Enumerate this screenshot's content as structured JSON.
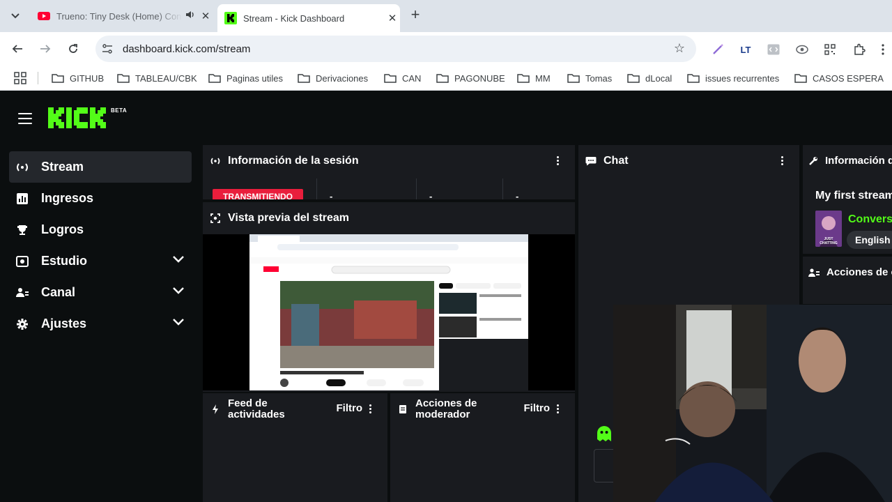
{
  "browser": {
    "tabs": [
      {
        "title": "Trueno: Tiny Desk (Home) Concert",
        "active": false
      },
      {
        "title": "Stream - Kick Dashboard",
        "active": true
      }
    ],
    "url": "dashboard.kick.com/stream",
    "bookmarks": [
      "GITHUB",
      "TABLEAU/CBK",
      "Paginas utiles",
      "Derivaciones",
      "CAN",
      "PAGONUBE",
      "MM",
      "Tomas",
      "dLocal",
      "issues recurrentes",
      "CASOS ESPERA"
    ]
  },
  "app": {
    "logo_badge": "BETA",
    "sidebar": [
      {
        "label": "Stream",
        "icon": "broadcast-icon",
        "active": true,
        "expandable": false
      },
      {
        "label": "Ingresos",
        "icon": "chart-icon",
        "active": false,
        "expandable": false
      },
      {
        "label": "Logros",
        "icon": "trophy-icon",
        "active": false,
        "expandable": false
      },
      {
        "label": "Estudio",
        "icon": "studio-icon",
        "active": false,
        "expandable": true
      },
      {
        "label": "Canal",
        "icon": "channel-icon",
        "active": false,
        "expandable": true
      },
      {
        "label": "Ajustes",
        "icon": "gear-icon",
        "active": false,
        "expandable": true
      }
    ],
    "session": {
      "title": "Información de la sesión",
      "status": "TRANSMITIENDO",
      "stats": [
        "-",
        "-",
        "-"
      ]
    },
    "preview": {
      "title": "Vista previa del stream"
    },
    "chat": {
      "title": "Chat"
    },
    "stream_info": {
      "title": "Información de stream",
      "stream_title": "My first stream",
      "category": "Conversando",
      "category_badge": "JUST CHATTING",
      "language": "English"
    },
    "channel_actions": {
      "title": "Acciones de canal"
    },
    "activity_feed": {
      "title": "Feed de actividades",
      "filter": "Filtro"
    },
    "mod_actions": {
      "title": "Acciones de moderador",
      "filter": "Filtro"
    }
  },
  "colors": {
    "kick_green": "#53fc18",
    "live_red": "#e91e3c",
    "panel_bg": "#191b1f",
    "app_bg": "#0b0e0f"
  }
}
